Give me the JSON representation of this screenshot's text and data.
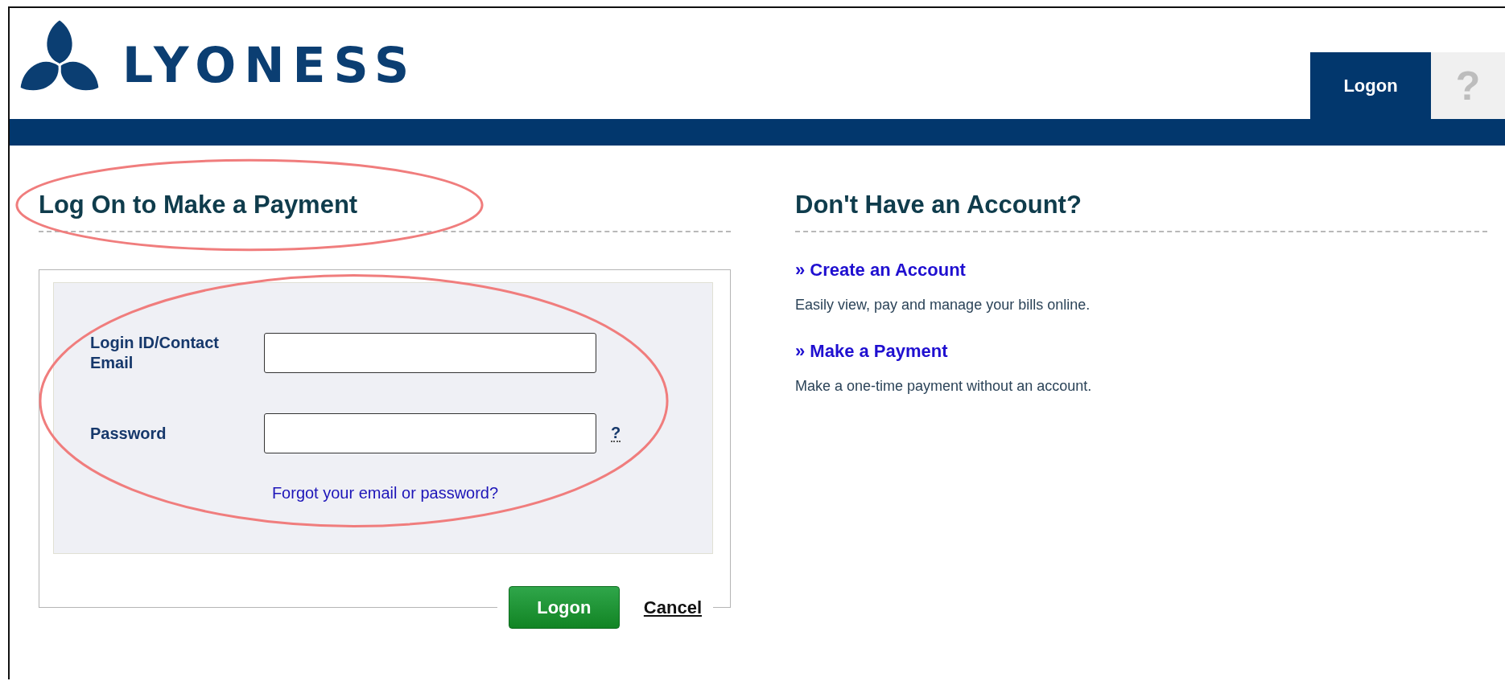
{
  "logo": {
    "text": "LYONESS"
  },
  "nav_tabs": [
    {
      "label": "Logon",
      "selected": true
    },
    {
      "label": "?",
      "selected": false
    }
  ],
  "login": {
    "heading": "Log On to Make a Payment",
    "heading_highlighted": true,
    "form_highlighted": true,
    "fields": [
      {
        "label": "Login ID/Contact Email"
      },
      {
        "label": "Password",
        "help": "?"
      }
    ],
    "forgot_link": "Forgot your email or password?",
    "buttons": [
      {
        "label": "Logon",
        "kind": "primary"
      },
      {
        "label": "Cancel",
        "kind": "link"
      }
    ]
  },
  "signup": {
    "heading": "Don't Have an Account?",
    "links": [
      {
        "title": "» Create an Account",
        "description": "Easily view, pay and manage your bills online."
      },
      {
        "title": "» Make a Payment",
        "description": "Make a one-time payment without an account."
      }
    ]
  }
}
